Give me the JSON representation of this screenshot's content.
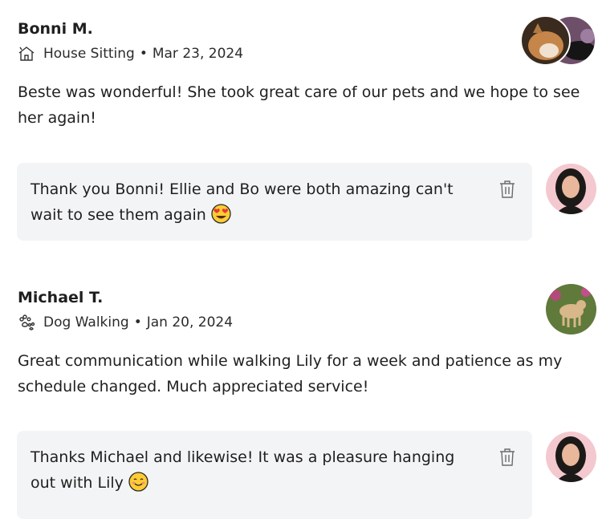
{
  "reviews": [
    {
      "reviewer": "Bonni M.",
      "service": "House Sitting",
      "separator": "•",
      "date": "Mar 23, 2024",
      "service_icon": "house-icon",
      "text": "Beste was wonderful! She took great care of our pets and we hope to see her again!",
      "reply": {
        "text": "Thank you Bonni! Ellie and Bo were both amazing can't wait to see them again",
        "emoji": "heart-eyes-emoji"
      }
    },
    {
      "reviewer": "Michael T.",
      "service": "Dog Walking",
      "separator": "•",
      "date": "Jan 20, 2024",
      "service_icon": "paw-icon",
      "text": "Great communication while walking Lily for a week and patience as my schedule changed. Much appreciated service!",
      "reply": {
        "text": "Thanks Michael and likewise! It was a pleasure hanging out with Lily",
        "emoji": "smiling-face-emoji"
      }
    }
  ],
  "colors": {
    "reply_bg": "#f3f4f6",
    "text": "#1f1f1f",
    "icon": "#6b6b6b"
  }
}
